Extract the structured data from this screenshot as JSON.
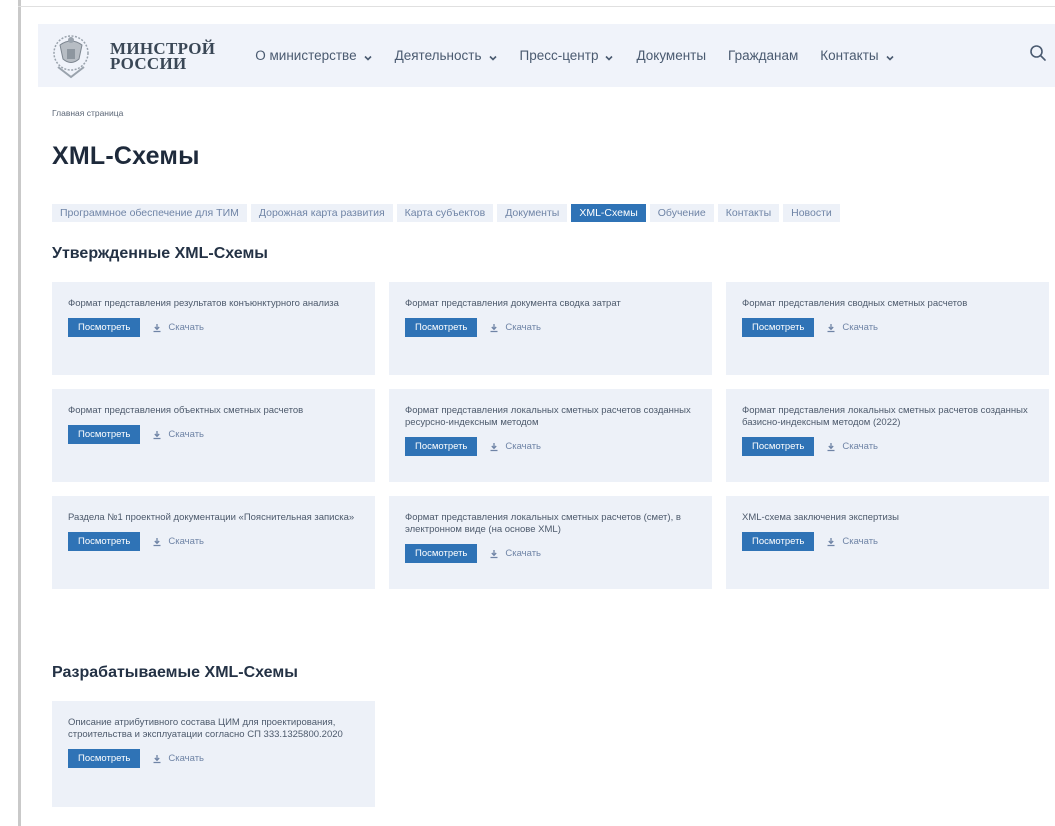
{
  "brand": {
    "line1": "МИНСТРОЙ",
    "line2": "РОССИИ"
  },
  "nav": [
    {
      "label": "О министерстве",
      "dropdown": true
    },
    {
      "label": "Деятельность",
      "dropdown": true
    },
    {
      "label": "Пресс-центр",
      "dropdown": true
    },
    {
      "label": "Документы",
      "dropdown": false
    },
    {
      "label": "Гражданам",
      "dropdown": false
    },
    {
      "label": "Контакты",
      "dropdown": true
    }
  ],
  "breadcrumb": "Главная страница",
  "page_title": "XML-Схемы",
  "tabs": [
    {
      "label": "Программное обеспечение для ТИМ",
      "active": false
    },
    {
      "label": "Дорожная карта развития",
      "active": false
    },
    {
      "label": "Карта субъектов",
      "active": false
    },
    {
      "label": "Документы",
      "active": false
    },
    {
      "label": "XML-Схемы",
      "active": true
    },
    {
      "label": "Обучение",
      "active": false
    },
    {
      "label": "Контакты",
      "active": false
    },
    {
      "label": "Новости",
      "active": false
    }
  ],
  "approved": {
    "title": "Утвержденные XML-Схемы",
    "cards": [
      {
        "title": "Формат представления результатов конъюнктурного анализа"
      },
      {
        "title": "Формат представления документа сводка затрат"
      },
      {
        "title": "Формат представления сводных сметных расчетов"
      },
      {
        "title": "Формат представления объектных сметных расчетов"
      },
      {
        "title": "Формат представления локальных сметных расчетов созданных ресурсно-индексным методом"
      },
      {
        "title": "Формат представления локальных сметных расчетов созданных базисно-индексным методом (2022)"
      },
      {
        "title": "Раздела №1 проектной документации «Пояснительная записка»"
      },
      {
        "title": "Формат представления локальных сметных расчетов (смет), в электронном виде (на основе XML)"
      },
      {
        "title": "XML-схема заключения экспертизы"
      }
    ]
  },
  "developing": {
    "title": "Разрабатываемые XML-Схемы",
    "cards": [
      {
        "title": "Описание атрибутивного состава ЦИМ для проектирования, строительства и эксплуатации согласно СП 333.1325800.2020"
      }
    ]
  },
  "actions": {
    "view_label": "Посмотреть",
    "download_label": "Скачать"
  },
  "icons": {
    "emblem": "coat-of-arms-icon",
    "search": "search-icon",
    "download": "download-icon",
    "chevron": "chevron-down-icon"
  },
  "colors": {
    "accent": "#2f73b6",
    "card_bg": "#edf1f8",
    "header_bg": "#f0f3fa",
    "tab_text": "#6f84a6"
  }
}
